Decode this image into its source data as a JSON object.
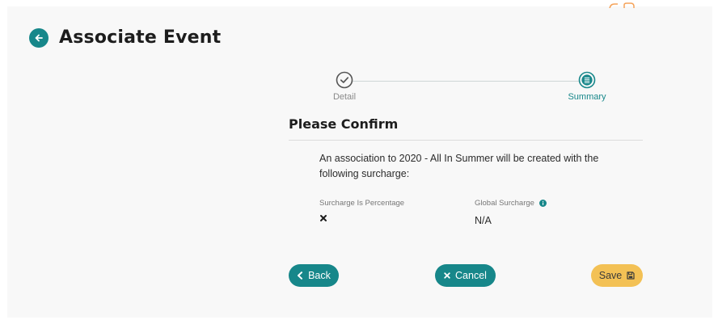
{
  "page": {
    "title": "Associate Event",
    "back_icon": "arrow-left-circle-icon"
  },
  "stepper": {
    "steps": [
      {
        "label": "Detail",
        "icon": "check-circle-icon",
        "state": "completed"
      },
      {
        "label": "Summary",
        "icon": "list-circle-icon",
        "state": "active"
      }
    ]
  },
  "confirm": {
    "title": "Please Confirm",
    "message": "An association to 2020 - All In Summer will be created with the following surcharge:",
    "fields": {
      "surcharge_pct": {
        "label": "Surcharge Is Percentage",
        "value_icon": "x-icon"
      },
      "global_surcharge": {
        "label": "Global Surcharge",
        "value": "N/A",
        "info_icon": "info-icon"
      }
    }
  },
  "actions": {
    "back_label": "Back",
    "cancel_label": "Cancel",
    "save_label": "Save"
  },
  "colors": {
    "primary": "#17878a",
    "save": "#f3c155",
    "accent_corner": "#f5a35a"
  }
}
